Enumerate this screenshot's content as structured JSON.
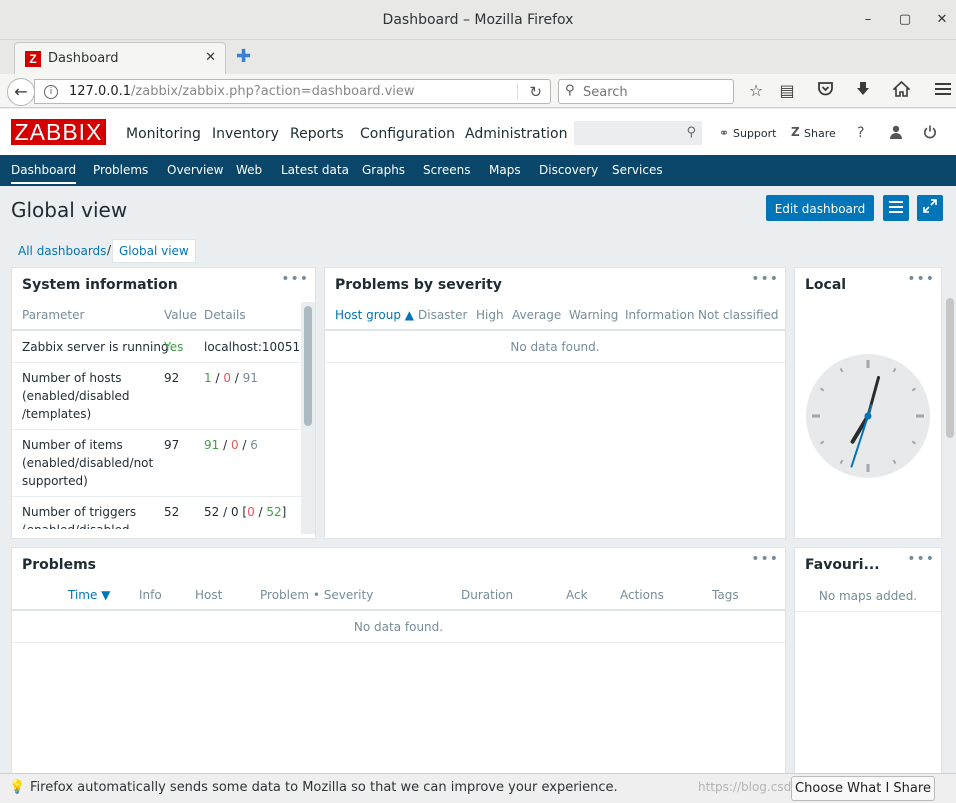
{
  "window": {
    "title": "Dashboard – Mozilla Firefox",
    "minimize": "–",
    "maximize": "▢",
    "close": "✕"
  },
  "tab": {
    "favicon": "Z",
    "label": "Dashboard",
    "close": "✕",
    "new_tab": "✚"
  },
  "navbar": {
    "back": "←",
    "url_host": "127.0.0.1",
    "url_path": "/zabbix/zabbix.php?action=dashboard.view",
    "reload": "↻",
    "search_placeholder": "Search",
    "icons": [
      "star-icon",
      "reader-list-icon",
      "pocket-icon",
      "download-icon",
      "home-icon",
      "hamburger-menu-icon"
    ]
  },
  "zabbix_header": {
    "logo": "ZABBIX",
    "menu": [
      "Monitoring",
      "Inventory",
      "Reports",
      "Configuration",
      "Administration"
    ],
    "active_menu": "Monitoring",
    "support": "Support",
    "share": "Share",
    "help": "?"
  },
  "submenu": [
    "Dashboard",
    "Problems",
    "Overview",
    "Web",
    "Latest data",
    "Graphs",
    "Screens",
    "Maps",
    "Discovery",
    "Services"
  ],
  "page": {
    "title": "Global view",
    "edit_button": "Edit dashboard",
    "breadcrumb": {
      "all": "All dashboards",
      "separator": "/",
      "current": "Global view"
    }
  },
  "system_information": {
    "title": "System information",
    "menu": "•••",
    "headers": {
      "parameter": "Parameter",
      "value": "Value",
      "details": "Details"
    },
    "rows": [
      {
        "param": "Zabbix server is running",
        "value": "Yes",
        "details": "localhost:10051"
      },
      {
        "param_lines": [
          "Number of hosts",
          "(enabled/disabled",
          "/templates)"
        ],
        "value": "92",
        "d1": "1",
        "d2": "0",
        "d3": "91"
      },
      {
        "param_lines": [
          "Number of items",
          "(enabled/disabled/not",
          "supported)"
        ],
        "value": "97",
        "d1": "91",
        "d2": "0",
        "d3": "6"
      },
      {
        "param_lines": [
          "Number of triggers",
          "(enabled/disabled"
        ],
        "value": "52",
        "d_prefix": "52 / 0 [",
        "d1": "0",
        "d2": "52",
        "d_suffix": "]"
      }
    ]
  },
  "problems_by_severity": {
    "title": "Problems by severity",
    "menu": "•••",
    "headers": [
      "Host group ▲",
      "Disaster",
      "High",
      "Average",
      "Warning",
      "Information",
      "Not classified"
    ],
    "empty": "No data found."
  },
  "local_clock": {
    "title": "Local",
    "menu": "•••",
    "hour": 7,
    "minute": 2,
    "second": 33
  },
  "problems": {
    "title": "Problems",
    "menu": "•••",
    "headers": [
      "Time ▼",
      "Info",
      "Host",
      "Problem • Severity",
      "Duration",
      "Ack",
      "Actions",
      "Tags"
    ],
    "empty": "No data found."
  },
  "favourite_maps": {
    "title": "Favouri...",
    "menu": "•••",
    "empty": "No maps added."
  },
  "notification": {
    "icon": "bulb-icon",
    "message": "Firefox automatically sends some data to Mozilla so that we can improve your experience.",
    "button": "Choose What I Share",
    "watermark": "https://blog.csdn.net/..."
  },
  "colors": {
    "accent": "#0275b8",
    "nav": "#0a466a",
    "logo": "#d40000",
    "ok": "#429e47",
    "problem": "#e45959"
  }
}
